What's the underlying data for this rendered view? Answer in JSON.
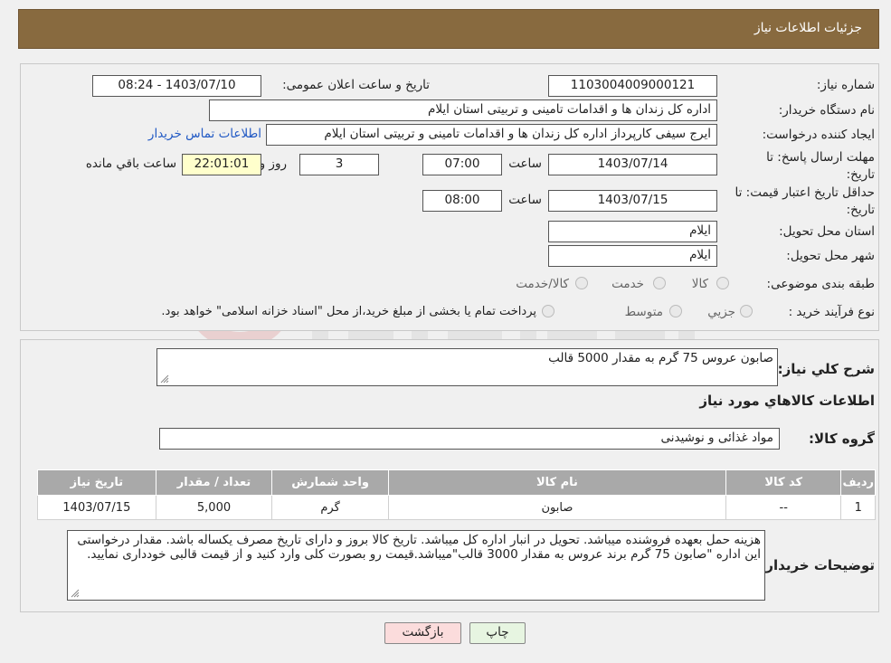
{
  "header": {
    "title": "جزئیات اطلاعات نیاز"
  },
  "info": {
    "need_number_label": "شماره نیاز:",
    "need_number": "1103004009000121",
    "announce_label": "تاریخ و ساعت اعلان عمومی:",
    "announce_value": "1403/07/10 - 08:24",
    "buyer_label": "نام دستگاه خریدار:",
    "buyer_value": "اداره کل زندان ها و اقدامات تامینی و تربیتی استان ایلام",
    "requester_label": "ایجاد کننده درخواست:",
    "requester_value": "ایرج  سیفی کارپرداز اداره کل زندان ها و اقدامات تامینی و تربیتی استان ایلام",
    "contact_link": "اطلاعات تماس خریدار",
    "deadline_label_1": "مهلت ارسال پاسخ: تا",
    "deadline_label_2": "تاریخ:",
    "deadline_date": "1403/07/14",
    "time_label": "ساعت",
    "deadline_time": "07:00",
    "days_value": "3",
    "days_label": "روز و",
    "remaining_value": "22:01:01",
    "remaining_label": "ساعت باقي مانده",
    "validity_label_1": "حداقل تاریخ اعتبار قیمت: تا",
    "validity_label_2": "تاریخ:",
    "validity_date": "1403/07/15",
    "validity_time": "08:00",
    "province_label": "استان محل تحویل:",
    "province_value": "ایلام",
    "city_label": "شهر محل تحویل:",
    "city_value": "ایلام",
    "category_label": "طبقه بندی موضوعی:",
    "category_options": [
      "کالا",
      "خدمت",
      "کالا/خدمت"
    ],
    "process_label": "نوع فرآیند خرید :",
    "process_options": [
      "جزيي",
      "متوسط"
    ],
    "process_note": "پرداخت تمام یا بخشی از مبلغ خرید،از محل \"اسناد خزانه اسلامی\" خواهد بود."
  },
  "details": {
    "summary_label": "شرح کلي نياز:",
    "summary_value": "صابون عروس 75 گرم به مقدار 5000 قالب",
    "goods_heading": "اطلاعات کالاهاي مورد نياز",
    "group_label": "گروه کالا:",
    "group_value": "مواد غذائی و نوشیدنی",
    "table": {
      "columns": [
        "رديف",
        "کد کالا",
        "نام کالا",
        "واحد شمارش",
        "تعداد / مقدار",
        "تاریخ نیاز"
      ],
      "rows": [
        [
          "1",
          "--",
          "صابون",
          "گرم",
          "5,000",
          "1403/07/15"
        ]
      ]
    },
    "buyer_notes_label": "توضیحات خریدار:",
    "buyer_notes_value": "هزینه حمل بعهده فروشنده میباشد. تحویل در انبار اداره کل میباشد. تاریخ کالا بروز و دارای تاریخ مصرف یکساله باشد. مقدار درخواستی این اداره \"صابون 75 گرم برند عروس به مقدار 3000 قالب\"میباشد.قیمت رو بصورت کلی وارد کنید و از قیمت قالبی خودداری نمایید."
  },
  "buttons": {
    "print": "چاپ",
    "back": "بازگشت"
  },
  "colors": {
    "header": "#886a3f",
    "table_header": "#a9a9a9",
    "print_button": "#e7f5e1",
    "back_button": "#fbdcdc"
  }
}
